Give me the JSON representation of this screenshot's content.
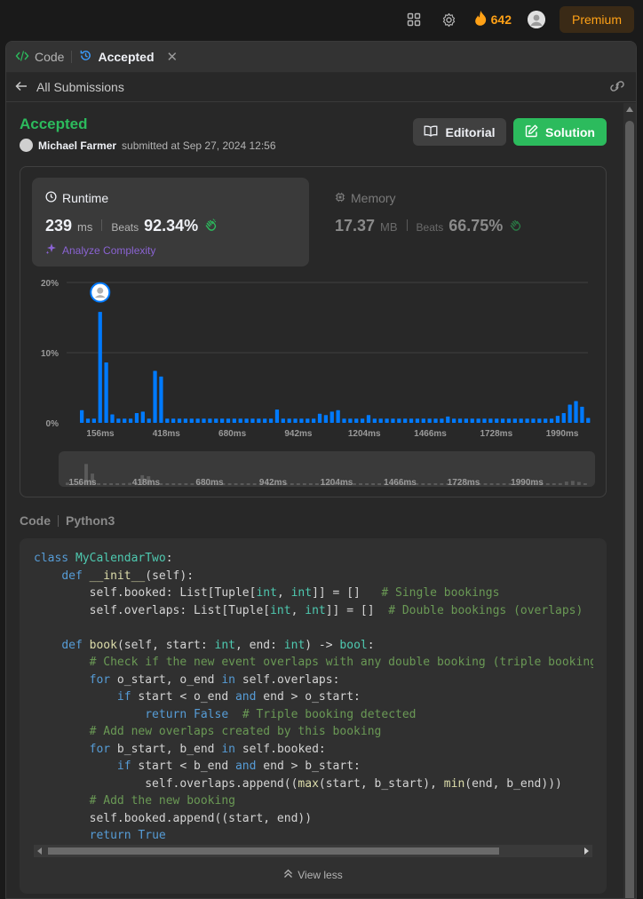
{
  "topnav": {
    "streak_count": "642",
    "premium_label": "Premium",
    "icons": [
      "layout-icon",
      "gear-icon",
      "fire-icon",
      "avatar"
    ],
    "accent": "#ffa116"
  },
  "tabs": [
    {
      "label": "Code",
      "icon": "code-icon"
    },
    {
      "label": "Accepted",
      "icon": "history-icon",
      "active": true
    }
  ],
  "subbar": {
    "back_label": "All Submissions"
  },
  "submission": {
    "status": "Accepted",
    "status_color": "#2cbb5d",
    "user": "Michael Farmer",
    "submitted_text": "submitted at Sep 27, 2024 12:56"
  },
  "buttons": {
    "editorial": "Editorial",
    "solution": "Solution"
  },
  "runtime": {
    "title": "Runtime",
    "value": "239",
    "unit": "ms",
    "beats_label": "Beats",
    "beats_pct": "92.34%",
    "analyze_label": "Analyze Complexity"
  },
  "memory": {
    "title": "Memory",
    "value": "17.37",
    "unit": "MB",
    "beats_label": "Beats",
    "beats_pct": "66.75%"
  },
  "chart_data": {
    "type": "bar",
    "title": "",
    "xlabel": "",
    "ylabel": "",
    "ylim": [
      0,
      20
    ],
    "y_ticks": [
      "20%",
      "10%",
      "0%"
    ],
    "x_tick_labels": [
      "156ms",
      "418ms",
      "680ms",
      "942ms",
      "1204ms",
      "1466ms",
      "1728ms",
      "1990ms"
    ],
    "values": [
      1.8,
      0.6,
      0.6,
      15.8,
      8.6,
      1.2,
      0.6,
      0.6,
      0.6,
      1.4,
      1.6,
      0.6,
      7.4,
      6.6,
      0.6,
      0.6,
      0.6,
      0.6,
      0.6,
      0.6,
      0.6,
      0.6,
      0.6,
      0.6,
      0.6,
      0.6,
      0.6,
      0.6,
      0.6,
      0.6,
      0.6,
      0.6,
      1.9,
      0.6,
      0.6,
      0.6,
      0.6,
      0.6,
      0.6,
      1.3,
      1.1,
      1.6,
      1.8,
      0.6,
      0.6,
      0.6,
      0.6,
      1.1,
      0.6,
      0.6,
      0.6,
      0.6,
      0.6,
      0.6,
      0.6,
      0.6,
      0.6,
      0.6,
      0.6,
      0.6,
      0.9,
      0.6,
      0.6,
      0.6,
      0.6,
      0.6,
      0.6,
      0.6,
      0.6,
      0.6,
      0.6,
      0.6,
      0.6,
      0.6,
      0.6,
      0.6,
      0.6,
      0.6,
      1.0,
      1.4,
      2.6,
      3.1,
      2.3,
      0.7
    ],
    "highlight_index": 3,
    "grid": true,
    "bar_color": "#007aff",
    "mini_labels": [
      "156ms",
      "418ms",
      "680ms",
      "942ms",
      "1204ms",
      "1466ms",
      "1728ms",
      "1990ms"
    ]
  },
  "code": {
    "label": "Code",
    "language": "Python3",
    "view_less_label": "View less"
  }
}
